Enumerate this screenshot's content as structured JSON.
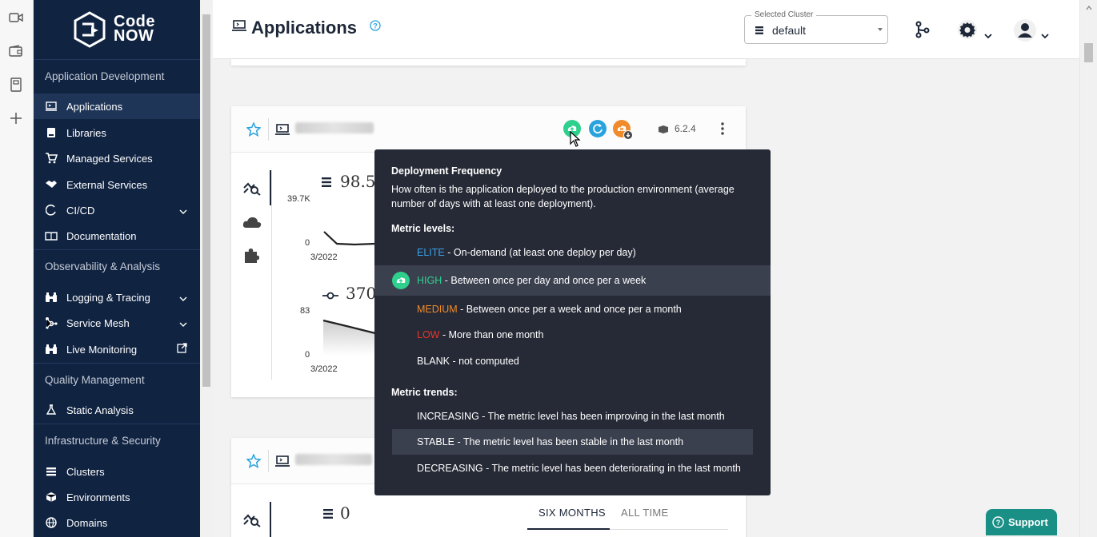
{
  "app": {
    "title": "Applications",
    "logo_line1": "Code",
    "logo_line2": "NOW"
  },
  "sidebar": {
    "sections": [
      {
        "label": "Application Development"
      },
      {
        "label": "Observability & Analysis"
      },
      {
        "label": "Quality Management"
      },
      {
        "label": "Infrastructure & Security"
      }
    ],
    "items": [
      {
        "label": "Applications"
      },
      {
        "label": "Libraries"
      },
      {
        "label": "Managed Services"
      },
      {
        "label": "External Services"
      },
      {
        "label": "CI/CD"
      },
      {
        "label": "Documentation"
      },
      {
        "label": "Logging & Tracing"
      },
      {
        "label": "Service Mesh"
      },
      {
        "label": "Live Monitoring"
      },
      {
        "label": "Static Analysis"
      },
      {
        "label": "Clusters"
      },
      {
        "label": "Environments"
      },
      {
        "label": "Domains"
      }
    ]
  },
  "header": {
    "cluster_label": "Selected Cluster",
    "cluster_value": "default"
  },
  "card1": {
    "version": "6.2.4",
    "metric1_value": "98.5",
    "metric1_ymax": "39.7K",
    "metric1_ymin": "0",
    "metric1_xstart": "3/2022",
    "metric2_value": "370",
    "metric2_ymax": "83",
    "metric2_ymin": "0",
    "metric2_xstart": "3/2022"
  },
  "card2": {
    "metric_value": "0",
    "tabs": [
      "SIX MONTHS",
      "ALL TIME"
    ]
  },
  "tooltip": {
    "title": "Deployment Frequency",
    "description": "How often is the application deployed to the production environment (average number of days with at least one deployment).",
    "levels_heading": "Metric levels:",
    "levels": [
      {
        "name": "ELITE",
        "text": " - On-demand (at least one deploy per day)",
        "color": "#3aa0e8"
      },
      {
        "name": "HIGH",
        "text": " - Between once per day and once per a week",
        "color": "#2fd08e"
      },
      {
        "name": "MEDIUM",
        "text": " - Between once per a week and once per a month",
        "color": "#f08a2a"
      },
      {
        "name": "LOW",
        "text": " - More than one month",
        "color": "#e8342a"
      },
      {
        "name": "BLANK",
        "text": " - not computed",
        "color": "#ffffff"
      }
    ],
    "trends_heading": "Metric trends:",
    "trends": [
      {
        "text": "INCREASING - The metric level has been improving in the last month"
      },
      {
        "text": "STABLE - The metric level has been stable in the last month"
      },
      {
        "text": "DECREASING - The metric level has been deteriorating in the last month"
      }
    ]
  },
  "support": {
    "label": "Support"
  },
  "colors": {
    "sidebar": "#102341",
    "accent": "#29a3dd",
    "high": "#2fd08e",
    "tooltip": "#262a36"
  }
}
